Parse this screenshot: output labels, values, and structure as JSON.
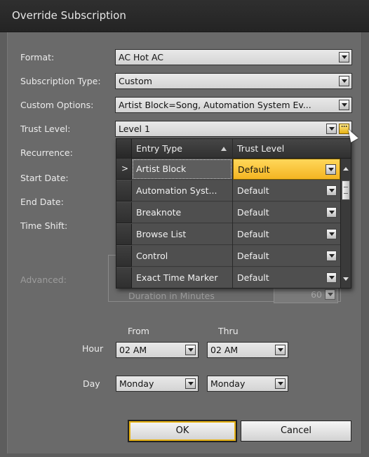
{
  "window": {
    "title": "Override Subscription"
  },
  "form": {
    "format_label": "Format:",
    "format_value": "AC Hot AC",
    "subscription_type_label": "Subscription Type:",
    "subscription_type_value": "Custom",
    "custom_options_label": "Custom Options:",
    "custom_options_value": "Artist Block=Song, Automation System Ev...",
    "trust_level_label": "Trust Level:",
    "trust_level_value": "Level 1",
    "recurrence_label": "Recurrence:",
    "start_date_label": "Start Date:",
    "end_date_label": "End Date:",
    "time_shift_label": "Time Shift:",
    "advanced_label": "Advanced:",
    "duration_label": "Duration in Minutes",
    "duration_value": "60",
    "from_label": "From",
    "thru_label": "Thru",
    "hour_label": "Hour",
    "hour_from": "02 AM",
    "hour_thru": "02 AM",
    "day_label": "Day",
    "day_from": "Monday",
    "day_thru": "Monday"
  },
  "grid": {
    "columns": [
      "Entry Type",
      "Trust Level"
    ],
    "rows": [
      {
        "entry_type": "Artist Block",
        "trust_level": "Default",
        "current": true
      },
      {
        "entry_type": "Automation Syst...",
        "trust_level": "Default"
      },
      {
        "entry_type": "Breaknote",
        "trust_level": "Default"
      },
      {
        "entry_type": "Browse List",
        "trust_level": "Default"
      },
      {
        "entry_type": "Control",
        "trust_level": "Default"
      },
      {
        "entry_type": "Exact Time Marker",
        "trust_level": "Default"
      }
    ],
    "row_indicator": ">"
  },
  "buttons": {
    "ok": "OK",
    "cancel": "Cancel"
  },
  "icons": {
    "dropdown": "chevron-down-icon",
    "ellipsis": "ellipsis-icon",
    "sort": "sort-ascending-icon",
    "cursor": "mouse-pointer-icon"
  },
  "colors": {
    "title_bar": "#2f2f2f",
    "panel": "#6a6a6a",
    "highlight": "#f4b522"
  }
}
